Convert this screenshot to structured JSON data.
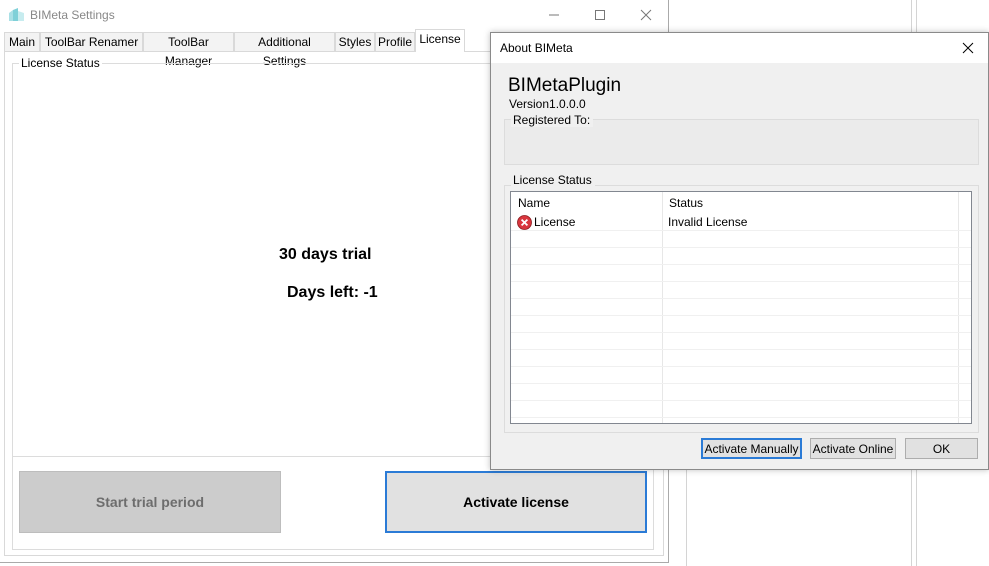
{
  "settings_window": {
    "title": "BIMeta Settings",
    "tabs": [
      {
        "label": "Main"
      },
      {
        "label": "ToolBar Renamer"
      },
      {
        "label": "ToolBar Manager"
      },
      {
        "label": "Additional Settings"
      },
      {
        "label": "Styles"
      },
      {
        "label": "Profile"
      },
      {
        "label": "License"
      }
    ],
    "active_tab": "License",
    "license_group_title": "License Status",
    "trial_label": "30 days trial",
    "days_left_label": "Days left: -1",
    "start_trial_button": "Start trial period",
    "activate_license_button": "Activate license"
  },
  "about_dialog": {
    "title": "About BIMeta",
    "product_name": "BIMetaPlugin",
    "version": "Version1.0.0.0",
    "registered_to_label": "Registered To:",
    "license_status_label": "License Status",
    "table": {
      "columns": [
        "Name",
        "Status"
      ],
      "rows": [
        {
          "name": "License",
          "status": "Invalid License"
        }
      ]
    },
    "buttons": {
      "activate_manually": "Activate Manually",
      "activate_online": "Activate Online",
      "ok": "OK"
    }
  },
  "colors": {
    "accent": "#2b7bd6",
    "error": "#d9363e"
  },
  "icons": {
    "app_icon": "bimeta-app-icon",
    "error_icon": "error-circle-icon"
  }
}
